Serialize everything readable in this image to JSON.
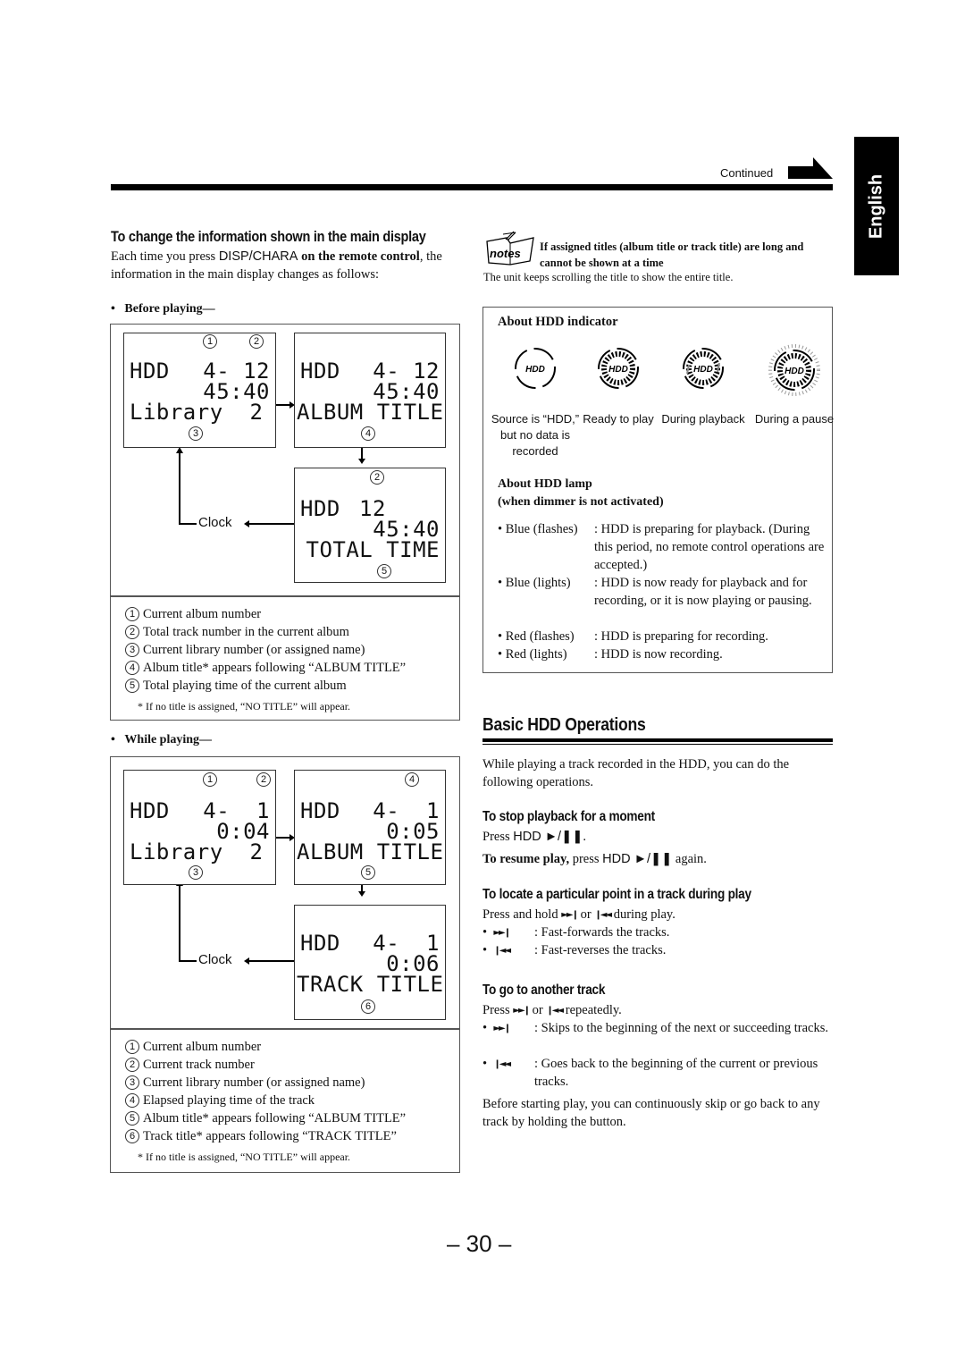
{
  "header": {
    "continued_label": "Continued",
    "language_tab": "English"
  },
  "left": {
    "title": "To change the information shown in the main display",
    "intro_pre": "Each time you press ",
    "intro_key": "DISP/CHARA",
    "intro_bold": " on the remote control",
    "intro_post": ", the information in the main display changes as follows:",
    "before": {
      "heading": "Before playing—",
      "screens": [
        {
          "line1_left": "HDD",
          "line1_right": "4- 12",
          "line2": "45:40",
          "line3": "Library  2"
        },
        {
          "line1_left": "HDD",
          "line1_right": "4- 12",
          "line2": "45:40",
          "line3": "ALBUM TITLE"
        },
        {
          "line1_left": "HDD",
          "line1_right": "12",
          "line2": "45:40",
          "line3": "TOTAL TIME"
        }
      ],
      "callouts": [
        "1",
        "2",
        "3",
        "4",
        "2",
        "5"
      ],
      "clock_label": "Clock",
      "legend": [
        {
          "num": "1",
          "text": "Current album number"
        },
        {
          "num": "2",
          "text": "Total track number in the current album"
        },
        {
          "num": "3",
          "text": "Current library number (or assigned name)"
        },
        {
          "num": "4",
          "text": "Album title* appears following “ALBUM TITLE”"
        },
        {
          "num": "5",
          "text": "Total playing time of the current album"
        }
      ],
      "footnote": "*  If no title is assigned, “NO TITLE” will appear."
    },
    "while": {
      "heading": "While playing—",
      "screens": [
        {
          "line1_left": "HDD",
          "line1_right": "4-  1",
          "line2": "0:04",
          "line3": "Library  2"
        },
        {
          "line1_left": "HDD",
          "line1_right": "4-  1",
          "line2": "0:05",
          "line3": "ALBUM TITLE"
        },
        {
          "line1_left": "HDD",
          "line1_right": "4-  1",
          "line2": "0:06",
          "line3": "TRACK TITLE"
        }
      ],
      "callouts": [
        "1",
        "2",
        "4",
        "3",
        "5",
        "6"
      ],
      "clock_label": "Clock",
      "legend": [
        {
          "num": "1",
          "text": "Current album number"
        },
        {
          "num": "2",
          "text": "Current track number"
        },
        {
          "num": "3",
          "text": "Current library number (or assigned name)"
        },
        {
          "num": "4",
          "text": "Elapsed playing time of the track"
        },
        {
          "num": "5",
          "text": "Album title* appears following “ALBUM TITLE”"
        },
        {
          "num": "6",
          "text": "Track title* appears following “TRACK TITLE”"
        }
      ],
      "footnote": "*  If no title is assigned, “NO TITLE” will appear."
    }
  },
  "right": {
    "notes": {
      "icon_label": "notes",
      "title": "If assigned titles (album title or track title) are long and cannot be shown at a time",
      "body": "The unit keeps scrolling the title to show the entire title."
    },
    "hdd_indicator": {
      "title": "About HDD indicator",
      "items": [
        {
          "icon": "hdd-indicator-empty-icon",
          "label": "Source is “HDD,” but no data is recorded"
        },
        {
          "icon": "hdd-indicator-ready-icon",
          "label": "Ready to play"
        },
        {
          "icon": "hdd-indicator-playback-icon",
          "label": "During playback"
        },
        {
          "icon": "hdd-indicator-pause-icon",
          "label": "During a pause"
        }
      ]
    },
    "hdd_lamp": {
      "title_line1": "About HDD lamp",
      "title_line2": "(when dimmer is not activated)",
      "rows": [
        {
          "label": "• Blue (flashes)",
          "desc": ": HDD is preparing for playback. (During this period, no remote control operations are accepted.)"
        },
        {
          "label": "• Blue (lights)",
          "desc": ": HDD is now ready for playback and for recording, or it is now playing or pausing."
        },
        {
          "label": "• Red (flashes)",
          "desc": ": HDD is preparing for recording."
        },
        {
          "label": "• Red (lights)",
          "desc": ": HDD is now recording."
        }
      ]
    },
    "basic_ops": {
      "title": "Basic HDD Operations",
      "intro": "While playing a track recorded in the HDD, you can do the following operations.",
      "stop": {
        "title": "To stop playback for a moment",
        "press_pre": "Press ",
        "press_key": "HDD ►/❚❚",
        "press_post": ".",
        "resume_bold": "To resume play,",
        "resume_pre": " press ",
        "resume_key": "HDD ►/❚❚",
        "resume_post": " again."
      },
      "locate": {
        "title": "To locate a particular point in a track during play",
        "intro_pre": "Press and hold ",
        "intro_fwd": "►►❙",
        "intro_mid": " or ",
        "intro_rev": "❙◄◄",
        "intro_post": " during play.",
        "items": [
          {
            "sym": "►►❙",
            "desc": ":  Fast-forwards the tracks."
          },
          {
            "sym": "❙◄◄",
            "desc": ":  Fast-reverses the tracks."
          }
        ]
      },
      "another": {
        "title": "To go to another track",
        "intro_pre": "Press ",
        "intro_fwd": "►►❙",
        "intro_mid": " or ",
        "intro_rev": "❙◄◄",
        "intro_post": " repeatedly.",
        "items": [
          {
            "sym": "►►❙",
            "desc": ":  Skips to the beginning of the next or succeeding tracks."
          },
          {
            "sym": "❙◄◄",
            "desc": ":  Goes back to the beginning of the current or previous tracks."
          }
        ],
        "outro": "Before starting play, you can continuously skip or go back to any track by holding the button."
      }
    }
  },
  "footer": {
    "page_number": "– 30 –"
  }
}
